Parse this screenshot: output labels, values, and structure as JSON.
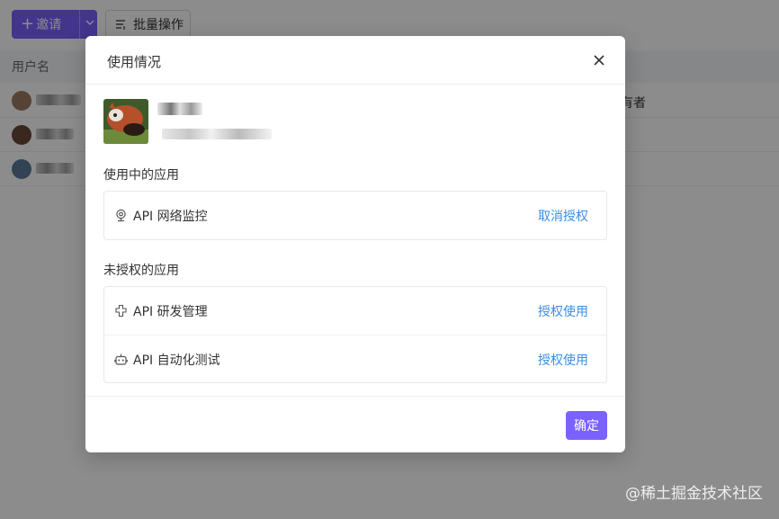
{
  "toolbar": {
    "invite_label": "邀请",
    "invite_plus": "+",
    "invite_chevron": "⌄",
    "batch_label": "批量操作"
  },
  "table": {
    "column_username": "用户名",
    "owner_text": "有者"
  },
  "modal": {
    "title": "使用情况",
    "close_icon": "close-icon",
    "sections": {
      "in_use_title": "使用中的应用",
      "unauthorized_title": "未授权的应用"
    },
    "in_use_apps": [
      {
        "name": "API 网络监控",
        "action": "取消授权",
        "icon": "webcam-icon"
      }
    ],
    "unauthorized_apps": [
      {
        "name": "API 研发管理",
        "action": "授权使用",
        "icon": "puzzle-icon"
      },
      {
        "name": "API 自动化测试",
        "action": "授权使用",
        "icon": "robot-icon"
      }
    ],
    "ok_label": "确定"
  },
  "watermark": "@稀土掘金技术社区",
  "colors": {
    "primary": "#7b61ff",
    "link": "#3a8ee6"
  }
}
